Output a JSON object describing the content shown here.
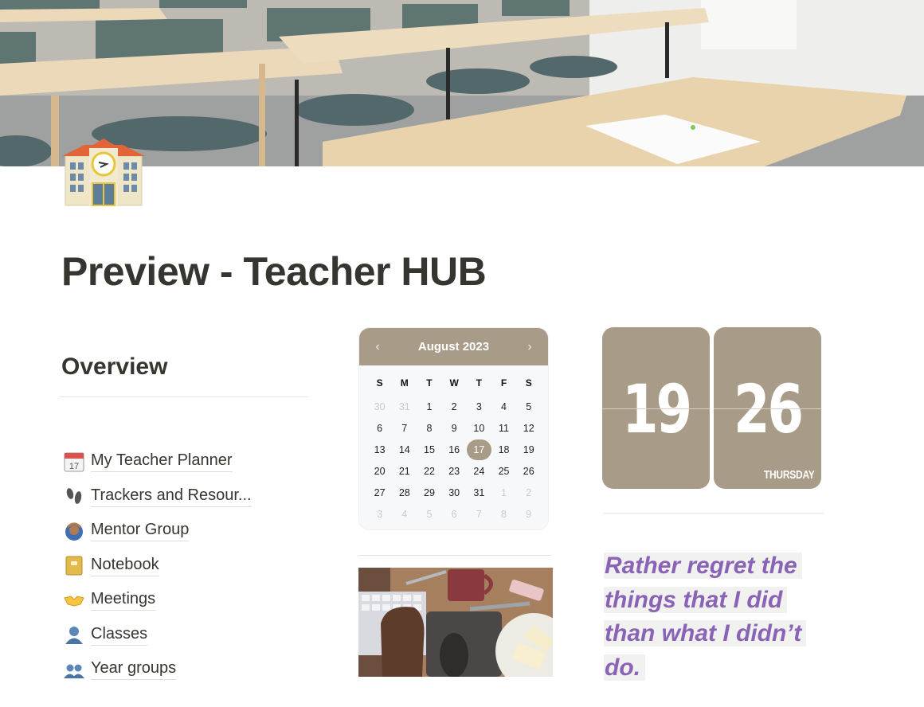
{
  "cover": {
    "alt": "Classroom with tables and chairs"
  },
  "page": {
    "icon": "school-building-icon",
    "title": "Preview - Teacher HUB"
  },
  "overview": {
    "heading": "Overview",
    "links": [
      {
        "icon": "calendar-icon",
        "label": "My Teacher Planner"
      },
      {
        "icon": "footprints-icon",
        "label": "Trackers and Resour..."
      },
      {
        "icon": "person-gesturing-ok-icon",
        "label": "Mentor Group"
      },
      {
        "icon": "notebook-icon",
        "label": "Notebook"
      },
      {
        "icon": "handshake-icon",
        "label": "Meetings"
      },
      {
        "icon": "bust-in-silhouette-icon",
        "label": "Classes"
      },
      {
        "icon": "busts-in-silhouette-icon",
        "label": "Year groups"
      }
    ]
  },
  "calendar": {
    "title": "August 2023",
    "prev": "‹",
    "next": "›",
    "weekdays": [
      "S",
      "M",
      "T",
      "W",
      "T",
      "F",
      "S"
    ],
    "today": 17,
    "weeks": [
      [
        {
          "d": "30",
          "m": true
        },
        {
          "d": "31",
          "m": true
        },
        {
          "d": "1"
        },
        {
          "d": "2"
        },
        {
          "d": "3"
        },
        {
          "d": "4"
        },
        {
          "d": "5"
        }
      ],
      [
        {
          "d": "6"
        },
        {
          "d": "7"
        },
        {
          "d": "8"
        },
        {
          "d": "9"
        },
        {
          "d": "10"
        },
        {
          "d": "11"
        },
        {
          "d": "12"
        }
      ],
      [
        {
          "d": "13"
        },
        {
          "d": "14"
        },
        {
          "d": "15"
        },
        {
          "d": "16"
        },
        {
          "d": "17",
          "t": true
        },
        {
          "d": "18"
        },
        {
          "d": "19"
        }
      ],
      [
        {
          "d": "20"
        },
        {
          "d": "21"
        },
        {
          "d": "22"
        },
        {
          "d": "23"
        },
        {
          "d": "24"
        },
        {
          "d": "25"
        },
        {
          "d": "26"
        }
      ],
      [
        {
          "d": "27"
        },
        {
          "d": "28"
        },
        {
          "d": "29"
        },
        {
          "d": "30"
        },
        {
          "d": "31"
        },
        {
          "d": "1",
          "m": true
        },
        {
          "d": "2",
          "m": true
        }
      ],
      [
        {
          "d": "3",
          "m": true
        },
        {
          "d": "4",
          "m": true
        },
        {
          "d": "5",
          "m": true
        },
        {
          "d": "6",
          "m": true
        },
        {
          "d": "7",
          "m": true
        },
        {
          "d": "8",
          "m": true
        },
        {
          "d": "9",
          "m": true
        }
      ]
    ]
  },
  "clock": {
    "hours": "19",
    "minutes": "26",
    "weekday": "THURSDAY"
  },
  "gif": {
    "alt": "Anime desk scene with keyboard, mouse, mug and sandwich"
  },
  "quote": {
    "lines": [
      "Rather regret the",
      "things that I did",
      "than what I didn’t",
      "do."
    ]
  },
  "colors": {
    "accent": "#a89b87",
    "quote": "#8863b6",
    "quote_bg": "#f1f1ef",
    "text": "#37352f"
  }
}
